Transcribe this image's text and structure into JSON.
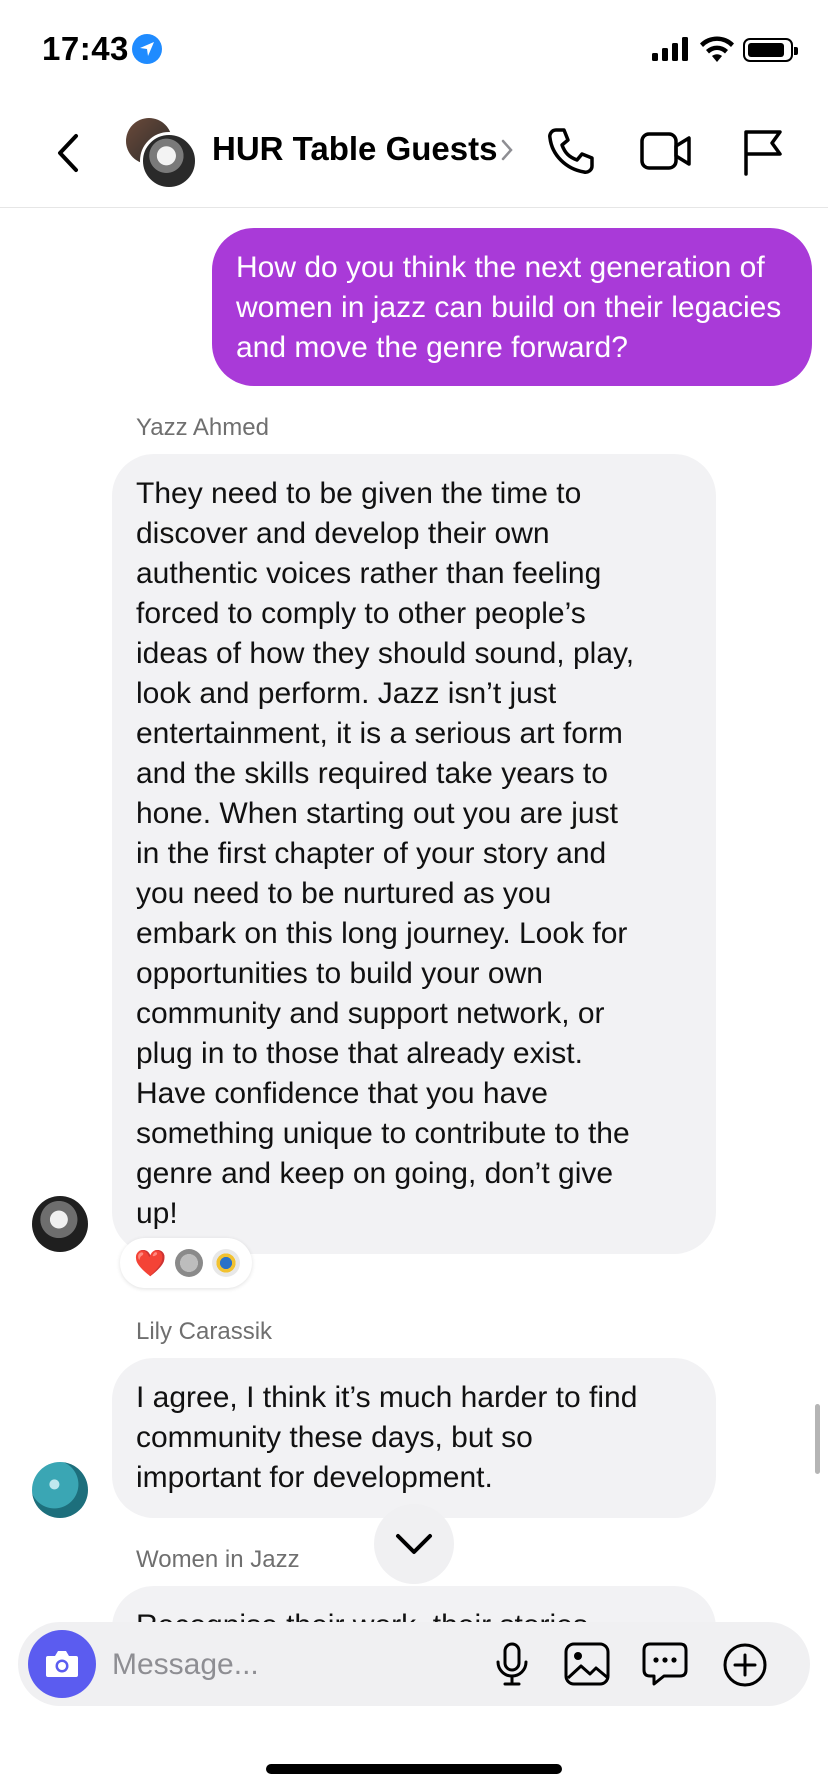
{
  "status_bar": {
    "time": "17:43"
  },
  "header": {
    "title": "HUR Table Guests"
  },
  "messages": [
    {
      "type": "sent",
      "text": "How do you think the next generation of women in jazz can build on their legacies and move the genre forward?"
    },
    {
      "type": "received",
      "sender": "Yazz Ahmed",
      "lines": [
        "They need to be given the time to",
        "discover and develop their own",
        "authentic voices rather than feeling",
        "forced to comply to other people’s",
        "ideas of how they should sound, play,",
        "look and perform. Jazz isn’t just",
        "entertainment, it is a serious art form",
        "and the skills required take years to",
        "hone. When starting out you are just",
        "in the first chapter of your story and",
        "you need to be nurtured as you",
        "embark on this long journey. Look for",
        "opportunities to build your own",
        "community and support network, or",
        "plug in to those that already exist.",
        "Have confidence that you have",
        "something unique to contribute to the",
        "genre and keep on going, don’t give",
        "up!"
      ],
      "reactions": [
        "❤️"
      ]
    },
    {
      "type": "received",
      "sender": "Lily Carassik",
      "lines": [
        "I agree, I think it’s much harder to find",
        "community these days, but so",
        "important for development."
      ]
    },
    {
      "type": "received",
      "sender": "Women in Jazz",
      "lines": [
        "Recognise their work, their stories"
      ]
    }
  ],
  "composer": {
    "placeholder": "Message..."
  },
  "colors": {
    "sent_bubble": "#a93ad8",
    "received_bubble": "#f2f2f4",
    "camera_button": "#5b5cf0"
  }
}
